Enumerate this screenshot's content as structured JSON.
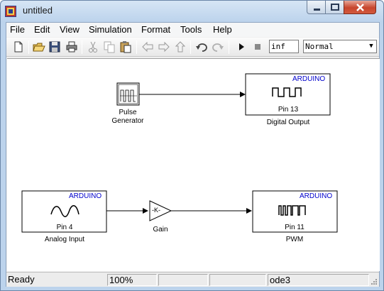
{
  "window": {
    "title": "untitled"
  },
  "menu": [
    "File",
    "Edit",
    "View",
    "Simulation",
    "Format",
    "Tools",
    "Help"
  ],
  "toolbar": {
    "stop_time": "inf",
    "sim_mode": "Normal"
  },
  "blocks": {
    "pulse": {
      "label_line1": "Pulse",
      "label_line2": "Generator"
    },
    "digital_output": {
      "tag": "ARDUINO",
      "pin": "Pin 13",
      "name": "Digital Output"
    },
    "analog_input": {
      "tag": "ARDUINO",
      "pin": "Pin 4",
      "name": "Analog Input"
    },
    "gain": {
      "glyph": "-K-",
      "name": "Gain"
    },
    "pwm": {
      "tag": "ARDUINO",
      "pin": "Pin 11",
      "name": "PWM"
    }
  },
  "status": {
    "state": "Ready",
    "zoom": "100%",
    "solver": "ode3"
  },
  "icons": [
    "new-model-icon",
    "open-icon",
    "save-icon",
    "print-icon",
    "cut-icon",
    "copy-icon",
    "paste-icon",
    "back-icon",
    "forward-icon",
    "up-icon",
    "undo-icon",
    "redo-icon",
    "start-simulation-icon",
    "stop-simulation-icon"
  ]
}
